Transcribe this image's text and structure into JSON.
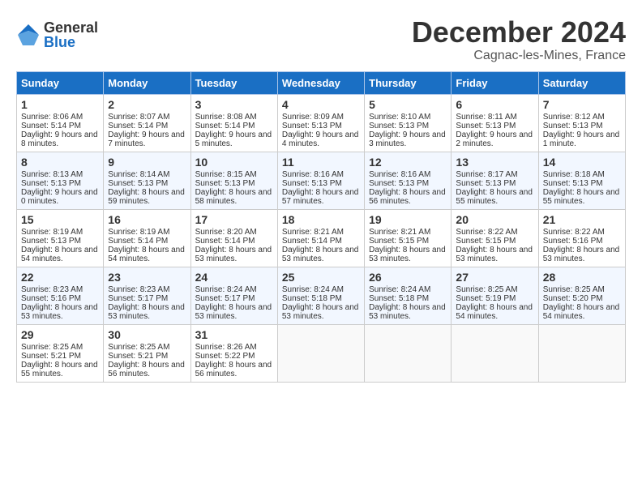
{
  "header": {
    "logo": {
      "general": "General",
      "blue": "Blue"
    },
    "title": "December 2024",
    "location": "Cagnac-les-Mines, France"
  },
  "weekdays": [
    "Sunday",
    "Monday",
    "Tuesday",
    "Wednesday",
    "Thursday",
    "Friday",
    "Saturday"
  ],
  "weeks": [
    [
      {
        "day": "1",
        "sunrise": "Sunrise: 8:06 AM",
        "sunset": "Sunset: 5:14 PM",
        "daylight": "Daylight: 9 hours and 8 minutes."
      },
      {
        "day": "2",
        "sunrise": "Sunrise: 8:07 AM",
        "sunset": "Sunset: 5:14 PM",
        "daylight": "Daylight: 9 hours and 7 minutes."
      },
      {
        "day": "3",
        "sunrise": "Sunrise: 8:08 AM",
        "sunset": "Sunset: 5:14 PM",
        "daylight": "Daylight: 9 hours and 5 minutes."
      },
      {
        "day": "4",
        "sunrise": "Sunrise: 8:09 AM",
        "sunset": "Sunset: 5:13 PM",
        "daylight": "Daylight: 9 hours and 4 minutes."
      },
      {
        "day": "5",
        "sunrise": "Sunrise: 8:10 AM",
        "sunset": "Sunset: 5:13 PM",
        "daylight": "Daylight: 9 hours and 3 minutes."
      },
      {
        "day": "6",
        "sunrise": "Sunrise: 8:11 AM",
        "sunset": "Sunset: 5:13 PM",
        "daylight": "Daylight: 9 hours and 2 minutes."
      },
      {
        "day": "7",
        "sunrise": "Sunrise: 8:12 AM",
        "sunset": "Sunset: 5:13 PM",
        "daylight": "Daylight: 9 hours and 1 minute."
      }
    ],
    [
      {
        "day": "8",
        "sunrise": "Sunrise: 8:13 AM",
        "sunset": "Sunset: 5:13 PM",
        "daylight": "Daylight: 9 hours and 0 minutes."
      },
      {
        "day": "9",
        "sunrise": "Sunrise: 8:14 AM",
        "sunset": "Sunset: 5:13 PM",
        "daylight": "Daylight: 8 hours and 59 minutes."
      },
      {
        "day": "10",
        "sunrise": "Sunrise: 8:15 AM",
        "sunset": "Sunset: 5:13 PM",
        "daylight": "Daylight: 8 hours and 58 minutes."
      },
      {
        "day": "11",
        "sunrise": "Sunrise: 8:16 AM",
        "sunset": "Sunset: 5:13 PM",
        "daylight": "Daylight: 8 hours and 57 minutes."
      },
      {
        "day": "12",
        "sunrise": "Sunrise: 8:16 AM",
        "sunset": "Sunset: 5:13 PM",
        "daylight": "Daylight: 8 hours and 56 minutes."
      },
      {
        "day": "13",
        "sunrise": "Sunrise: 8:17 AM",
        "sunset": "Sunset: 5:13 PM",
        "daylight": "Daylight: 8 hours and 55 minutes."
      },
      {
        "day": "14",
        "sunrise": "Sunrise: 8:18 AM",
        "sunset": "Sunset: 5:13 PM",
        "daylight": "Daylight: 8 hours and 55 minutes."
      }
    ],
    [
      {
        "day": "15",
        "sunrise": "Sunrise: 8:19 AM",
        "sunset": "Sunset: 5:13 PM",
        "daylight": "Daylight: 8 hours and 54 minutes."
      },
      {
        "day": "16",
        "sunrise": "Sunrise: 8:19 AM",
        "sunset": "Sunset: 5:14 PM",
        "daylight": "Daylight: 8 hours and 54 minutes."
      },
      {
        "day": "17",
        "sunrise": "Sunrise: 8:20 AM",
        "sunset": "Sunset: 5:14 PM",
        "daylight": "Daylight: 8 hours and 53 minutes."
      },
      {
        "day": "18",
        "sunrise": "Sunrise: 8:21 AM",
        "sunset": "Sunset: 5:14 PM",
        "daylight": "Daylight: 8 hours and 53 minutes."
      },
      {
        "day": "19",
        "sunrise": "Sunrise: 8:21 AM",
        "sunset": "Sunset: 5:15 PM",
        "daylight": "Daylight: 8 hours and 53 minutes."
      },
      {
        "day": "20",
        "sunrise": "Sunrise: 8:22 AM",
        "sunset": "Sunset: 5:15 PM",
        "daylight": "Daylight: 8 hours and 53 minutes."
      },
      {
        "day": "21",
        "sunrise": "Sunrise: 8:22 AM",
        "sunset": "Sunset: 5:16 PM",
        "daylight": "Daylight: 8 hours and 53 minutes."
      }
    ],
    [
      {
        "day": "22",
        "sunrise": "Sunrise: 8:23 AM",
        "sunset": "Sunset: 5:16 PM",
        "daylight": "Daylight: 8 hours and 53 minutes."
      },
      {
        "day": "23",
        "sunrise": "Sunrise: 8:23 AM",
        "sunset": "Sunset: 5:17 PM",
        "daylight": "Daylight: 8 hours and 53 minutes."
      },
      {
        "day": "24",
        "sunrise": "Sunrise: 8:24 AM",
        "sunset": "Sunset: 5:17 PM",
        "daylight": "Daylight: 8 hours and 53 minutes."
      },
      {
        "day": "25",
        "sunrise": "Sunrise: 8:24 AM",
        "sunset": "Sunset: 5:18 PM",
        "daylight": "Daylight: 8 hours and 53 minutes."
      },
      {
        "day": "26",
        "sunrise": "Sunrise: 8:24 AM",
        "sunset": "Sunset: 5:18 PM",
        "daylight": "Daylight: 8 hours and 53 minutes."
      },
      {
        "day": "27",
        "sunrise": "Sunrise: 8:25 AM",
        "sunset": "Sunset: 5:19 PM",
        "daylight": "Daylight: 8 hours and 54 minutes."
      },
      {
        "day": "28",
        "sunrise": "Sunrise: 8:25 AM",
        "sunset": "Sunset: 5:20 PM",
        "daylight": "Daylight: 8 hours and 54 minutes."
      }
    ],
    [
      {
        "day": "29",
        "sunrise": "Sunrise: 8:25 AM",
        "sunset": "Sunset: 5:21 PM",
        "daylight": "Daylight: 8 hours and 55 minutes."
      },
      {
        "day": "30",
        "sunrise": "Sunrise: 8:25 AM",
        "sunset": "Sunset: 5:21 PM",
        "daylight": "Daylight: 8 hours and 56 minutes."
      },
      {
        "day": "31",
        "sunrise": "Sunrise: 8:26 AM",
        "sunset": "Sunset: 5:22 PM",
        "daylight": "Daylight: 8 hours and 56 minutes."
      },
      null,
      null,
      null,
      null
    ]
  ]
}
